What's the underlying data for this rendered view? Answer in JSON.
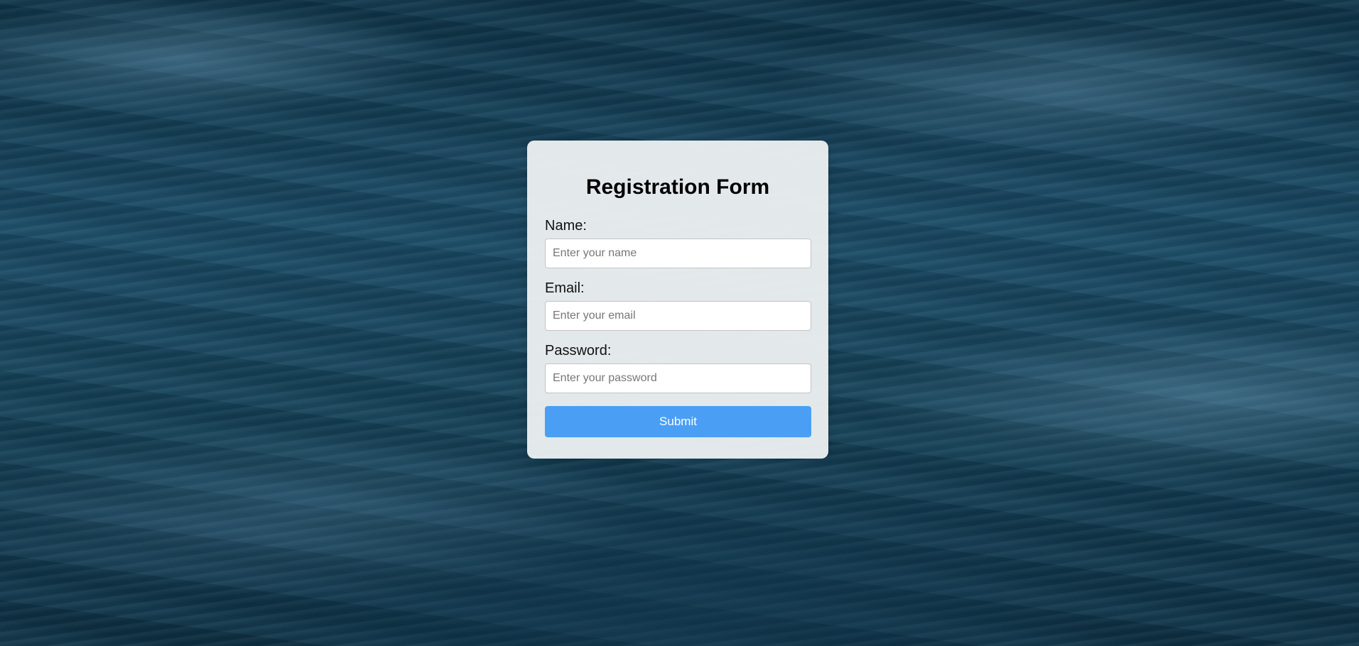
{
  "form": {
    "title": "Registration Form",
    "fields": [
      {
        "label": "Name:",
        "placeholder": "Enter your name",
        "value": ""
      },
      {
        "label": "Email:",
        "placeholder": "Enter your email",
        "value": ""
      },
      {
        "label": "Password:",
        "placeholder": "Enter your password",
        "value": ""
      }
    ],
    "submit_label": "Submit"
  },
  "colors": {
    "accent": "#4a9ff5",
    "card_background": "#eef1f2",
    "page_background": "#123a50"
  }
}
